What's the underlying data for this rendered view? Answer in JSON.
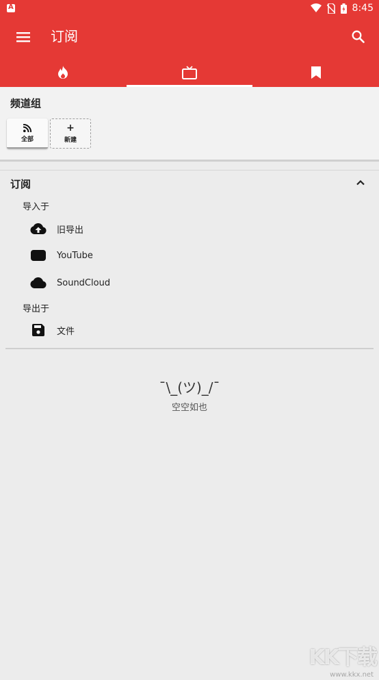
{
  "status_bar": {
    "time": "8:45"
  },
  "toolbar": {
    "title": "订阅",
    "menu_icon": "menu-icon",
    "search_icon": "search-icon"
  },
  "tabs": [
    {
      "icon": "fire-icon",
      "active": false
    },
    {
      "icon": "tv-icon",
      "active": true
    },
    {
      "icon": "bookmark-icon",
      "active": false
    }
  ],
  "channel_groups": {
    "title": "频道组",
    "items": [
      {
        "label": "全部",
        "icon": "rss-icon"
      },
      {
        "label": "新建",
        "icon": "plus-icon",
        "glyph": "+"
      }
    ]
  },
  "subscriptions": {
    "title": "订阅",
    "import_label": "导入于",
    "import_items": [
      {
        "label": "旧导出",
        "icon": "cloud-upload-icon"
      },
      {
        "label": "YouTube",
        "icon": "youtube-icon"
      },
      {
        "label": "SoundCloud",
        "icon": "cloud-icon"
      }
    ],
    "export_label": "导出于",
    "export_items": [
      {
        "label": "文件",
        "icon": "save-icon"
      }
    ]
  },
  "empty_state": {
    "face": "¯\\_(ツ)_/¯",
    "message": "空空如也"
  },
  "watermark": {
    "text": "KK下载",
    "url": "www.kkx.net"
  },
  "colors": {
    "primary": "#e53935",
    "background": "#ececec"
  }
}
